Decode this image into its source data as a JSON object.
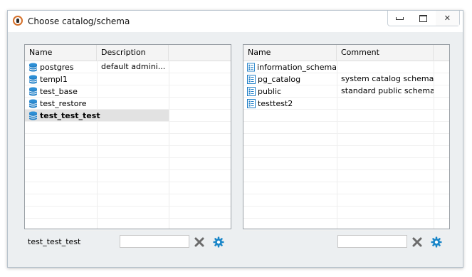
{
  "window": {
    "title": "Choose catalog/schema",
    "buttons": {
      "minimize": "minimize-icon",
      "maximize": "maximize-icon",
      "close": "close-icon"
    }
  },
  "catalogs": {
    "columns": [
      "Name",
      "Description"
    ],
    "rows": [
      {
        "name": "postgres",
        "description": "default admini..."
      },
      {
        "name": "templ1",
        "description": ""
      },
      {
        "name": "test_base",
        "description": ""
      },
      {
        "name": "test_restore",
        "description": ""
      },
      {
        "name": "test_test_test",
        "description": "",
        "selected": true
      }
    ]
  },
  "schemas": {
    "columns": [
      "Name",
      "Comment"
    ],
    "rows": [
      {
        "name": "information_schema",
        "comment": ""
      },
      {
        "name": "pg_catalog",
        "comment": "system catalog schema"
      },
      {
        "name": "public",
        "comment": "standard public schema"
      },
      {
        "name": "testtest2",
        "comment": ""
      }
    ]
  },
  "bottom": {
    "selected_catalog_label": "test_test_test",
    "catalog_filter_value": "",
    "schema_filter_value": ""
  },
  "colors": {
    "accent": "#1a86c8",
    "db_icon": "#1f7fc7",
    "selection": "#e2e2e2"
  }
}
